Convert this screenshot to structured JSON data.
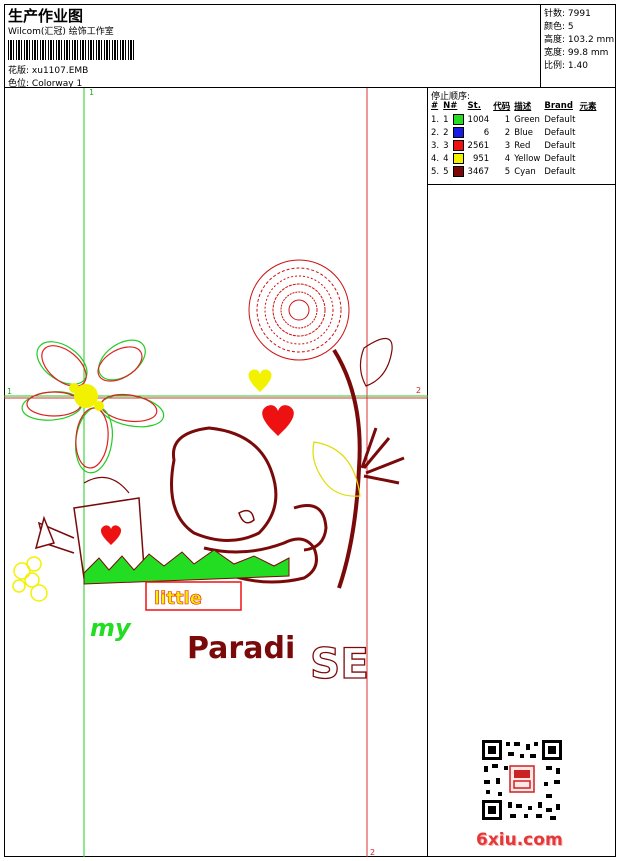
{
  "header": {
    "title": "生产作业图",
    "studio": "Wilcom(汇冠) 绘饰工作室",
    "design_label": "花版:",
    "design_value": "xu1107.EMB",
    "colorway_label": "色位:",
    "colorway_value": "Colorway 1"
  },
  "stats": [
    {
      "label": "针数:",
      "value": "7991"
    },
    {
      "label": "颜色:",
      "value": "5"
    },
    {
      "label": "高度:",
      "value": "103.2 mm"
    },
    {
      "label": "宽度:",
      "value": "99.8 mm"
    },
    {
      "label": "比例:",
      "value": "1.40"
    }
  ],
  "guides": {
    "h_marker_left": "1",
    "h_marker_right": "2",
    "v_marker_top": "1",
    "v_marker_bottom": "2"
  },
  "design_text": {
    "my": "my",
    "little": "little",
    "paradi": "Paradi",
    "se": "SE"
  },
  "stop_sequence": {
    "title": "停止顺序:",
    "columns": [
      "#",
      "N#",
      "St.",
      "代码",
      "描述",
      "Brand",
      "元素"
    ],
    "rows": [
      {
        "idx": "1.",
        "n": "1",
        "color": "#22dd22",
        "st": "1004",
        "code": "1",
        "desc": "Green",
        "brand": "Default"
      },
      {
        "idx": "2.",
        "n": "2",
        "color": "#1a1ae6",
        "st": "6",
        "code": "2",
        "desc": "Blue",
        "brand": "Default"
      },
      {
        "idx": "3.",
        "n": "3",
        "color": "#ee1111",
        "st": "2561",
        "code": "3",
        "desc": "Red",
        "brand": "Default"
      },
      {
        "idx": "4.",
        "n": "4",
        "color": "#f2f200",
        "st": "951",
        "code": "4",
        "desc": "Yellow",
        "brand": "Default"
      },
      {
        "idx": "5.",
        "n": "5",
        "color": "#7a0a0a",
        "st": "3467",
        "code": "5",
        "desc": "Cyan",
        "brand": "Default"
      }
    ]
  },
  "watermark": {
    "text": "6xiu.com",
    "qr_icon": "qr-code-icon"
  }
}
